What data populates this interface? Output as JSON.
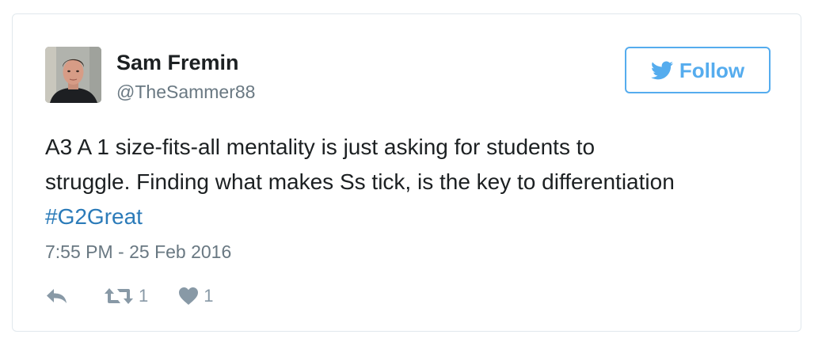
{
  "tweet": {
    "author_name": "Sam Fremin",
    "author_handle": "@TheSammer88",
    "text_line1": "A3 A 1 size-fits-all mentality is just asking for students to",
    "text_line2": "struggle. Finding what makes Ss tick, is the key to differentiation",
    "hashtag": "#G2Great",
    "timestamp": "7:55 PM - 25 Feb 2016",
    "retweet_count": "1",
    "like_count": "1"
  },
  "follow_button": {
    "label": "Follow",
    "icon": "twitter-bird-icon"
  },
  "icons": {
    "reply": "reply-arrow-icon",
    "retweet": "retweet-icon",
    "like": "heart-icon"
  },
  "colors": {
    "accent": "#55acee",
    "hashtag": "#2b7bb9",
    "muted": "#8899a6",
    "border": "#e1e8ed"
  }
}
